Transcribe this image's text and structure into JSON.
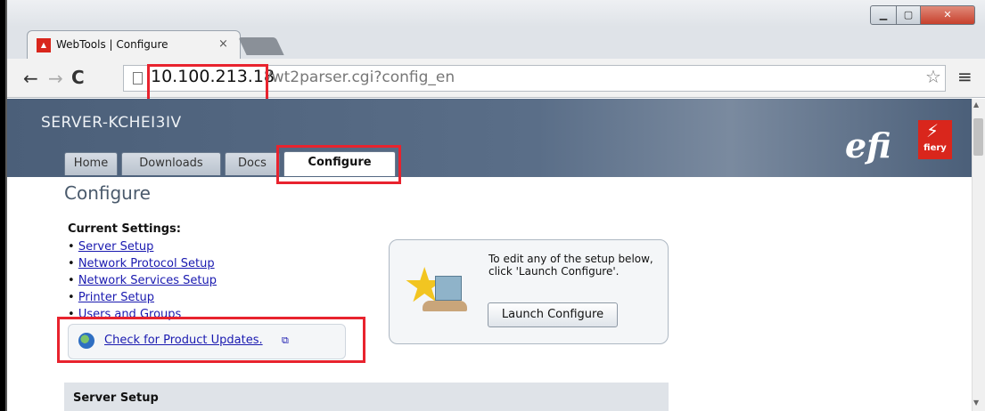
{
  "browser": {
    "tab_title": "WebTools | Configure",
    "tab_close": "×",
    "url_host": "10.100.213.18",
    "url_path": "/wt2parser.cgi?config_en"
  },
  "header": {
    "server_name": "SERVER-KCHEI3IV",
    "logo_text": "efi",
    "fiery_text": "fiery"
  },
  "nav_tabs": [
    {
      "label": "Home"
    },
    {
      "label": "Downloads"
    },
    {
      "label": "Docs"
    },
    {
      "label": "Configure",
      "active": true
    }
  ],
  "main": {
    "title": "Configure",
    "settings_heading": "Current Settings:",
    "settings": [
      {
        "label": "Server Setup"
      },
      {
        "label": "Network Protocol Setup"
      },
      {
        "label": "Network Services Setup"
      },
      {
        "label": "Printer Setup"
      },
      {
        "label": "Users and Groups"
      }
    ],
    "updates_link": "Check for Product Updates.",
    "launch_text": "To edit any of the setup below, click 'Launch Configure'.",
    "launch_button": "Launch Configure",
    "section_title": "Server Setup"
  },
  "icons": {
    "back": "back-arrow-icon",
    "forward": "forward-arrow-icon",
    "reload": "reload-icon",
    "star": "bookmark-star-icon",
    "menu": "hamburger-menu-icon",
    "globe": "globe-icon",
    "external": "external-link-icon"
  },
  "colors": {
    "highlight": "#e8232e",
    "link": "#1a1ab0",
    "header_bg": "#4b5f79",
    "fiery_red": "#d9261c"
  }
}
